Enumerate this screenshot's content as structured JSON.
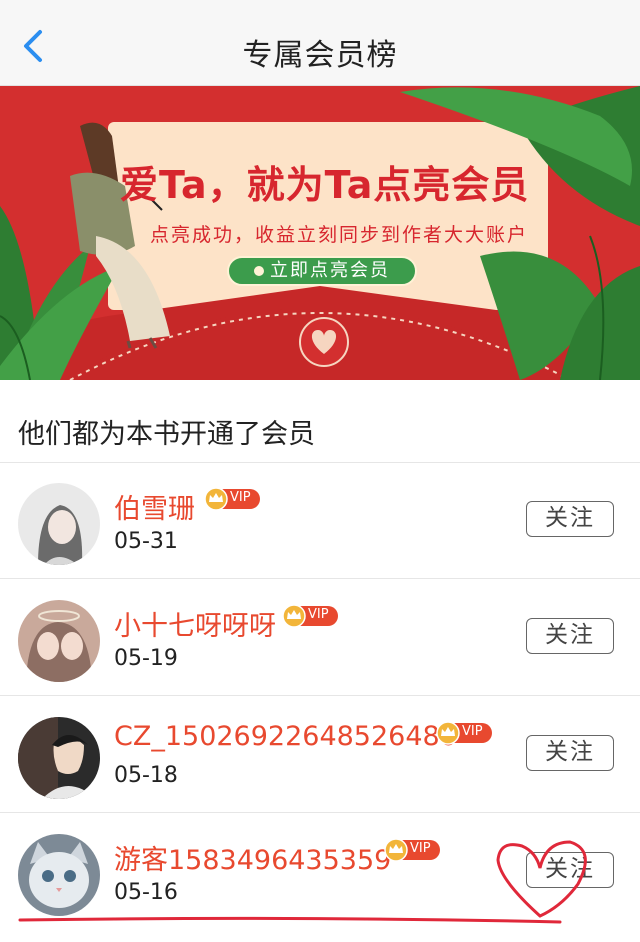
{
  "header": {
    "title": "专属会员榜",
    "back_icon": "chevron-left-icon"
  },
  "banner": {
    "headline": "爱Ta，就为Ta点亮会员",
    "subtitle": "点亮成功，收益立刻同步到作者大大账户",
    "cta_label": "立即点亮会员",
    "colors": {
      "background": "#d32f2f",
      "card": "#fde3c8",
      "accent_green": "#3c9c4c",
      "text_red": "#d7262e"
    }
  },
  "section": {
    "title": "他们都为本书开通了会员"
  },
  "vip_badge_label": "VIP",
  "members": [
    {
      "name": "伯雪珊",
      "date": "05-31",
      "follow_label": "关注"
    },
    {
      "name": "小十七呀呀呀",
      "date": "05-19",
      "follow_label": "关注"
    },
    {
      "name": "CZ_15026922648526480",
      "date": "05-18",
      "follow_label": "关注"
    },
    {
      "name": "游客1583496435359",
      "date": "05-16",
      "follow_label": "关注"
    }
  ],
  "colors": {
    "name_red": "#e8492f",
    "annotation_red": "#e0283a"
  }
}
